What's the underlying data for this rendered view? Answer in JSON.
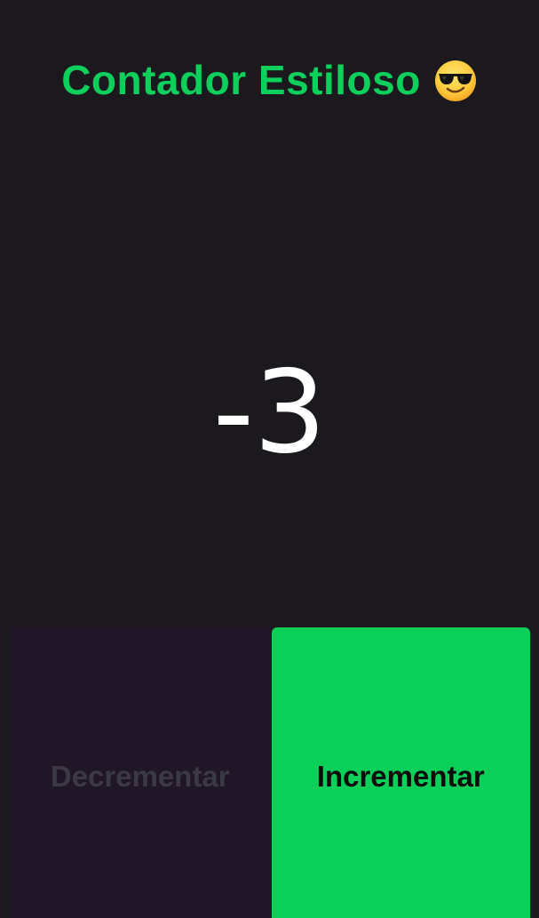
{
  "header": {
    "title": "Contador Estiloso",
    "icon": "sunglasses-face-icon"
  },
  "counter": {
    "value": "-3"
  },
  "buttons": {
    "decrement_label": "Decrementar",
    "increment_label": "Incrementar",
    "decrement_state": "disabled"
  },
  "colors": {
    "background": "#1b191d",
    "accent": "#0acf58",
    "title": "#0ccf5c",
    "decrement_bg": "#201628",
    "decrement_text": "#3c3844",
    "counter_text": "#ffffff"
  }
}
